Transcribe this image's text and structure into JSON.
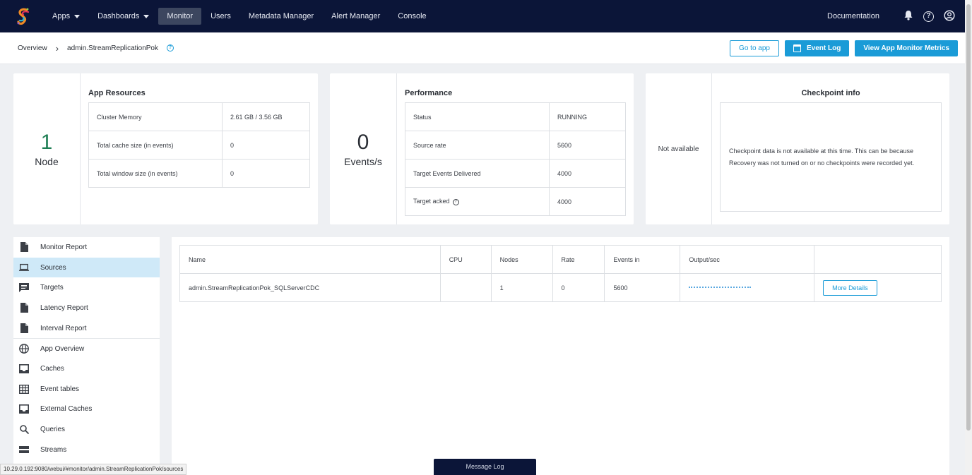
{
  "nav": {
    "items": [
      {
        "label": "Apps",
        "caret": true,
        "active": false
      },
      {
        "label": "Dashboards",
        "caret": true,
        "active": false
      },
      {
        "label": "Monitor",
        "caret": false,
        "active": true
      },
      {
        "label": "Users",
        "caret": false,
        "active": false
      },
      {
        "label": "Metadata Manager",
        "caret": false,
        "active": false
      },
      {
        "label": "Alert Manager",
        "caret": false,
        "active": false
      },
      {
        "label": "Console",
        "caret": false,
        "active": false
      }
    ],
    "documentation": "Documentation"
  },
  "header": {
    "breadcrumb_root": "Overview",
    "breadcrumb_current": "admin.StreamReplicationPok",
    "go_to_app": "Go to app",
    "event_log": "Event Log",
    "view_metrics": "View App Monitor Metrics"
  },
  "resources": {
    "count": "1",
    "unit": "Node",
    "title": "App Resources",
    "rows": [
      {
        "label": "Cluster Memory",
        "value": "2.61 GB / 3.56 GB"
      },
      {
        "label": "Total cache size (in events)",
        "value": "0"
      },
      {
        "label": "Total window size (in events)",
        "value": "0"
      }
    ]
  },
  "performance": {
    "count": "0",
    "unit": "Events/s",
    "title": "Performance",
    "rows": [
      {
        "label": "Status",
        "value": "RUNNING"
      },
      {
        "label": "Source rate",
        "value": "5600"
      },
      {
        "label": "Target Events Delivered",
        "value": "4000"
      },
      {
        "label": "Target acked",
        "value": "4000"
      }
    ]
  },
  "checkpoint": {
    "left": "Not available",
    "title": "Checkpoint info",
    "message": "Checkpoint data is not available at this time. This can be because Recovery was not turned on or no checkpoints were recorded yet."
  },
  "sidebar": {
    "items": [
      {
        "label": "Monitor Report",
        "icon": "file-icon",
        "active": false,
        "divider": false
      },
      {
        "label": "Sources",
        "icon": "laptop-icon",
        "active": true,
        "divider": false
      },
      {
        "label": "Targets",
        "icon": "message-icon",
        "active": false,
        "divider": false
      },
      {
        "label": "Latency Report",
        "icon": "file-icon",
        "active": false,
        "divider": false
      },
      {
        "label": "Interval Report",
        "icon": "file-icon",
        "active": false,
        "divider": false
      },
      {
        "label": "App Overview",
        "icon": "globe-icon",
        "active": false,
        "divider": true
      },
      {
        "label": "Caches",
        "icon": "inbox-icon",
        "active": false,
        "divider": false
      },
      {
        "label": "Event tables",
        "icon": "grid-icon",
        "active": false,
        "divider": false
      },
      {
        "label": "External Caches",
        "icon": "inbox-icon",
        "active": false,
        "divider": false
      },
      {
        "label": "Queries",
        "icon": "search-icon",
        "active": false,
        "divider": false
      },
      {
        "label": "Streams",
        "icon": "stream-icon",
        "active": false,
        "divider": false
      }
    ]
  },
  "sources_table": {
    "headers": [
      "Name",
      "CPU",
      "Nodes",
      "Rate",
      "Events in",
      "Output/sec",
      ""
    ],
    "rows": [
      {
        "name": "admin.StreamReplicationPok_SQLServerCDC",
        "cpu": "",
        "nodes": "1",
        "rate": "0",
        "events_in": "5600",
        "action": "More Details"
      }
    ]
  },
  "footer": {
    "message_log": "Message Log",
    "status_url": "10.29.0.192:9080/webui/#monitor/admin.StreamReplicationPok/sources"
  },
  "colors": {
    "nav_bg": "#0b1538",
    "accent": "#1a9bd7",
    "active_sidebar": "#cfe9f8",
    "resource_count": "#1e7e54"
  }
}
